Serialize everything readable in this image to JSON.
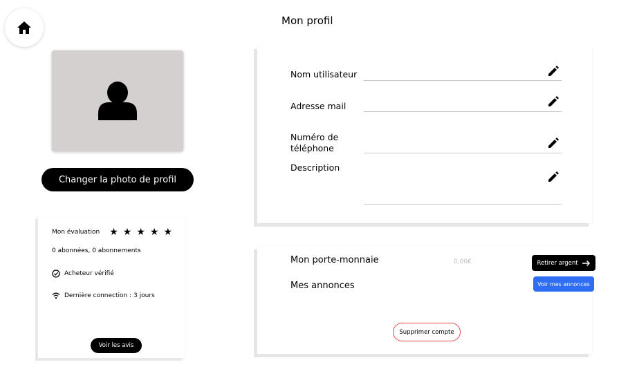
{
  "header": {
    "title": "Mon profil",
    "home_icon": "home-icon"
  },
  "photo": {
    "avatar_icon": "user-silhouette-icon",
    "change_label": "Changer la photo de profil"
  },
  "stats": {
    "rating_label": "Mon évaluation",
    "rating_stars": 5,
    "followers": "0 abonnées, 0 abonnements",
    "verified": "Acheteur vérifié",
    "last_connection": "Dernière connection : 3 jours",
    "reviews_button": "Voir les avis"
  },
  "profile": {
    "fields": [
      {
        "label": "Nom utilisateur",
        "value": ""
      },
      {
        "label": "Adresse mail",
        "value": ""
      },
      {
        "label": "Numéro de téléphone",
        "value": ""
      },
      {
        "label": "Description",
        "value": ""
      }
    ]
  },
  "wallet": {
    "label": "Mon porte-monnaie",
    "amount": "0,00€",
    "withdraw_button": "Retirer argent",
    "ads_label": "Mes annonces",
    "ads_button": "Voir mes annonces",
    "delete_button": "Supprimer compte"
  },
  "colors": {
    "primary": "#000000",
    "accent_blue": "#2f6df2",
    "danger": "#e24a4a",
    "avatar_bg": "#d4d0cf"
  }
}
